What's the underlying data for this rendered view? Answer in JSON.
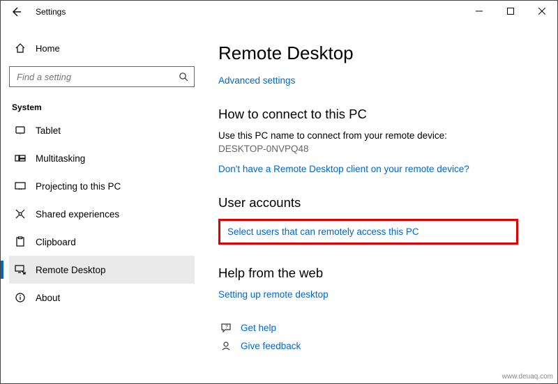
{
  "window": {
    "title": "Settings"
  },
  "sidebar": {
    "home": "Home",
    "search_placeholder": "Find a setting",
    "category": "System",
    "items": [
      {
        "icon": "tablet",
        "label": "Tablet"
      },
      {
        "icon": "multitasking",
        "label": "Multitasking"
      },
      {
        "icon": "projecting",
        "label": "Projecting to this PC"
      },
      {
        "icon": "shared",
        "label": "Shared experiences"
      },
      {
        "icon": "clipboard",
        "label": "Clipboard"
      },
      {
        "icon": "remote",
        "label": "Remote Desktop"
      },
      {
        "icon": "about",
        "label": "About"
      }
    ],
    "selected_index": 5
  },
  "main": {
    "heading": "Remote Desktop",
    "advanced_link": "Advanced settings",
    "connect_heading": "How to connect to this PC",
    "connect_desc": "Use this PC name to connect from your remote device:",
    "pc_name": "DESKTOP-0NVPQ48",
    "no_client_link": "Don't have a Remote Desktop client on your remote device?",
    "user_accounts_heading": "User accounts",
    "select_users_link": "Select users that can remotely access this PC",
    "help_heading": "Help from the web",
    "setup_link": "Setting up remote desktop",
    "get_help": "Get help",
    "give_feedback": "Give feedback"
  },
  "watermark": "www.deuaq.com"
}
